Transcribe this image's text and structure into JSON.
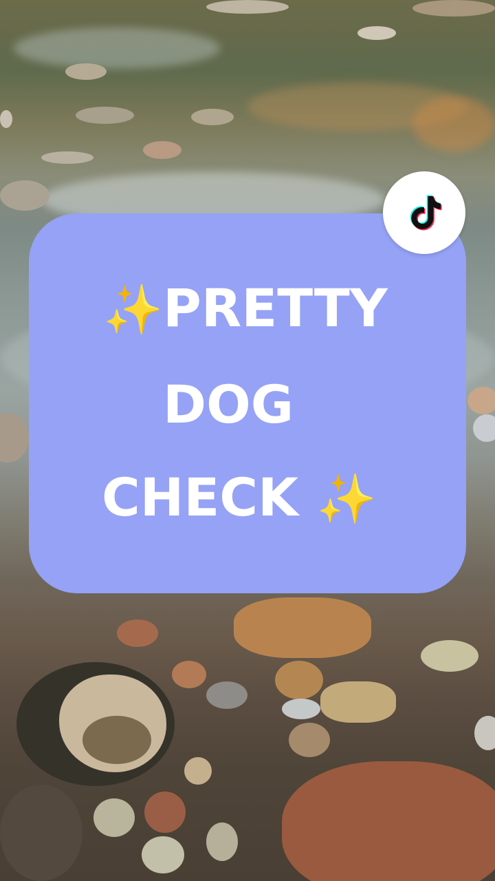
{
  "overlay": {
    "line_1_emoji": "✨",
    "line_1_text": "PRETTY",
    "line_2_text": "DOG",
    "line_3_text": "CHECK",
    "line_3_emoji": "✨",
    "card_color": "#95a2f5",
    "text_color": "#ffffff",
    "sparkle_color": "#f9c42a"
  },
  "badge": {
    "icon": "tiktok-logo-icon"
  }
}
